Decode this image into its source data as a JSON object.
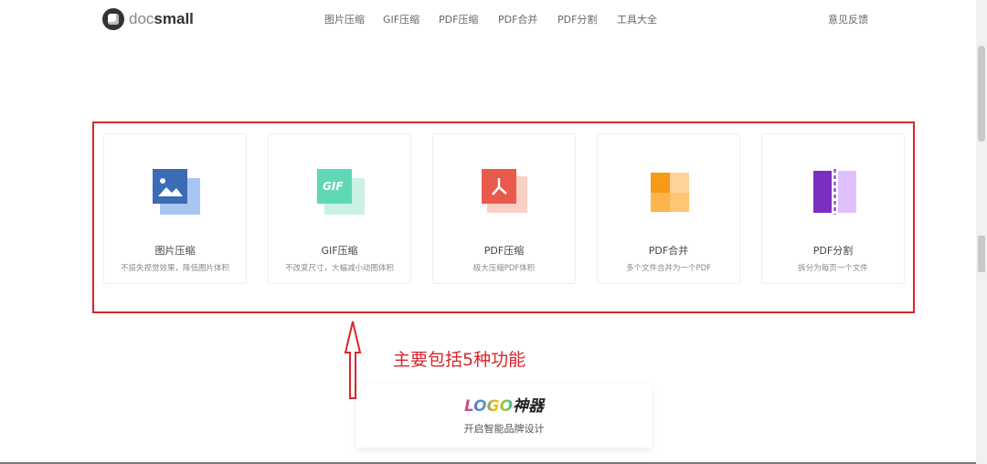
{
  "header": {
    "logo_light": "doc",
    "logo_bold": "small",
    "nav": [
      "图片压缩",
      "GIF压缩",
      "PDF压缩",
      "PDF合并",
      "PDF分割",
      "工具大全"
    ],
    "feedback": "意见反馈"
  },
  "cards": [
    {
      "title": "图片压缩",
      "desc": "不损失视觉效果，降低图片体积",
      "icon": "image-icon"
    },
    {
      "title": "GIF压缩",
      "desc": "不改变尺寸，大幅减小动图体积",
      "icon": "gif-icon",
      "icon_text": "GIF"
    },
    {
      "title": "PDF压缩",
      "desc": "极大压缩PDF体积",
      "icon": "pdf-icon"
    },
    {
      "title": "PDF合并",
      "desc": "多个文件合并为一个PDF",
      "icon": "puzzle-icon"
    },
    {
      "title": "PDF分割",
      "desc": "拆分为每页一个文件",
      "icon": "split-icon"
    }
  ],
  "annotation": "主要包括5种功能",
  "promo": {
    "logo_word": "LOGO",
    "logo_suffix": "神器",
    "subtitle": "开启智能品牌设计"
  },
  "colors": {
    "annotation": "#d8262c"
  }
}
